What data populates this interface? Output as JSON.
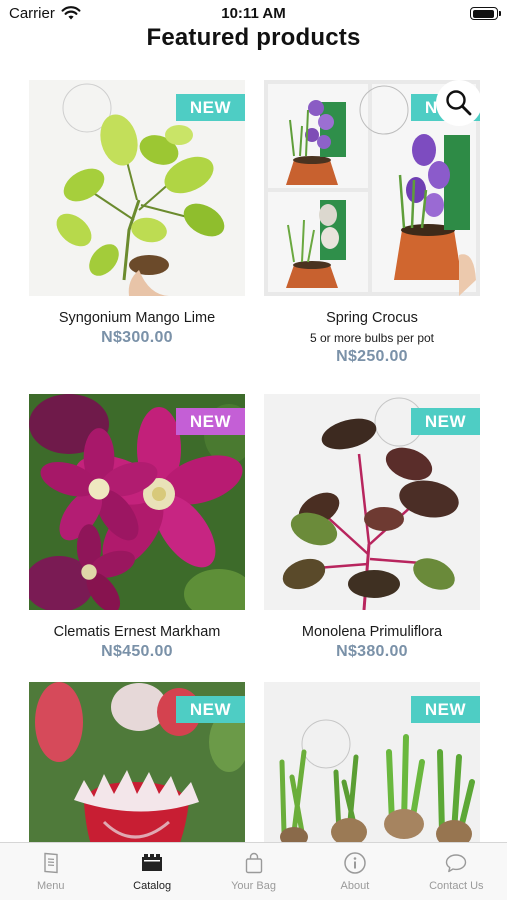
{
  "status_bar": {
    "carrier": "Carrier",
    "time": "10:11 AM"
  },
  "header": {
    "title": "Featured products"
  },
  "search": {
    "icon": "search-icon"
  },
  "products": [
    {
      "name": "Syngonium Mango Lime",
      "subtitle": "",
      "price": "N$300.00",
      "badge": "NEW",
      "badge_color": "#4ecdc4",
      "watermark": "Foliage"
    },
    {
      "name": "Spring Crocus",
      "subtitle": "5 or more bulbs per pot",
      "price": "N$250.00",
      "badge": "NEW",
      "badge_color": "#4ecdc4",
      "watermark": "Foliage"
    },
    {
      "name": "Clematis Ernest Markham",
      "subtitle": "",
      "price": "N$450.00",
      "badge": "NEW",
      "badge_color": "#c45fd6"
    },
    {
      "name": "Monolena Primuliflora",
      "subtitle": "",
      "price": "N$380.00",
      "badge": "NEW",
      "badge_color": "#4ecdc4",
      "watermark": "Foliage"
    },
    {
      "name": "",
      "subtitle": "",
      "price": "",
      "badge": "NEW",
      "badge_color": "#4ecdc4"
    },
    {
      "name": "",
      "subtitle": "",
      "price": "",
      "badge": "NEW",
      "badge_color": "#4ecdc4",
      "watermark": "Foliage"
    }
  ],
  "tabs": [
    {
      "label": "Menu",
      "icon": "menu-book-icon",
      "active": false
    },
    {
      "label": "Catalog",
      "icon": "catalog-icon",
      "active": true
    },
    {
      "label": "Your Bag",
      "icon": "shopping-bag-icon",
      "active": false
    },
    {
      "label": "About",
      "icon": "info-icon",
      "active": false
    },
    {
      "label": "Contact Us",
      "icon": "chat-bubble-icon",
      "active": false
    }
  ],
  "colors": {
    "accent_teal": "#4ecdc4",
    "accent_purple": "#c45fd6",
    "price": "#7a91a8"
  }
}
